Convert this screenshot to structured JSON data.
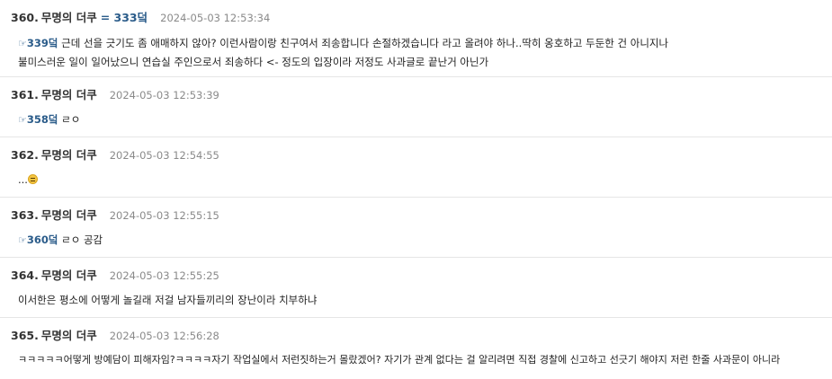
{
  "posts": [
    {
      "number": "360.",
      "name": "무명의 더쿠",
      "anchor": "= 333덬",
      "time": "2024-05-03 12:53:34",
      "pointer": "☞",
      "reply": "339덬",
      "line1": " 근데 선을 긋기도 좀 애매하지 않아? 이런사람이랑 친구여서 죄송합니다 손절하겠습니다 라고 올려야 하나..딱히 옹호하고 두둔한 건 아니지나",
      "line2": "불미스러운 일이 일어났으니 연습실 주인으로서 죄송하다 <- 정도의 입장이라 저정도 사과글로 끝난거 아닌가"
    },
    {
      "number": "361.",
      "name": "무명의 더쿠",
      "time": "2024-05-03 12:53:39",
      "pointer": "☞",
      "reply": "358덬",
      "text": " ㄹㅇ"
    },
    {
      "number": "362.",
      "name": "무명의 더쿠",
      "time": "2024-05-03 12:54:55",
      "text": "...",
      "emoji": "neutral-face-icon"
    },
    {
      "number": "363.",
      "name": "무명의 더쿠",
      "time": "2024-05-03 12:55:15",
      "pointer": "☞",
      "reply": "360덬",
      "text": " ㄹㅇ 공감"
    },
    {
      "number": "364.",
      "name": "무명의 더쿠",
      "time": "2024-05-03 12:55:25",
      "text": "이서한은 평소에 어떻게 놀길래 저걸 남자들끼리의 장난이라 치부하냐"
    },
    {
      "number": "365.",
      "name": "무명의 더쿠",
      "time": "2024-05-03 12:56:28",
      "text": "ㅋㅋㅋㅋㅋ어떻게 방예담이 피해자임?ㅋㅋㅋㅋ자기 작업실에서 저런짓하는거 몰랐겠어? 자기가 관계 없다는 걸 알리려면 직접 경찰에 신고하고 선긋기 해야지 저런 한줄 사과문이 아니라"
    }
  ],
  "colors": {
    "link": "#2b5c8a",
    "timestamp": "#8a8a8a",
    "divider": "#e6e6e6"
  }
}
